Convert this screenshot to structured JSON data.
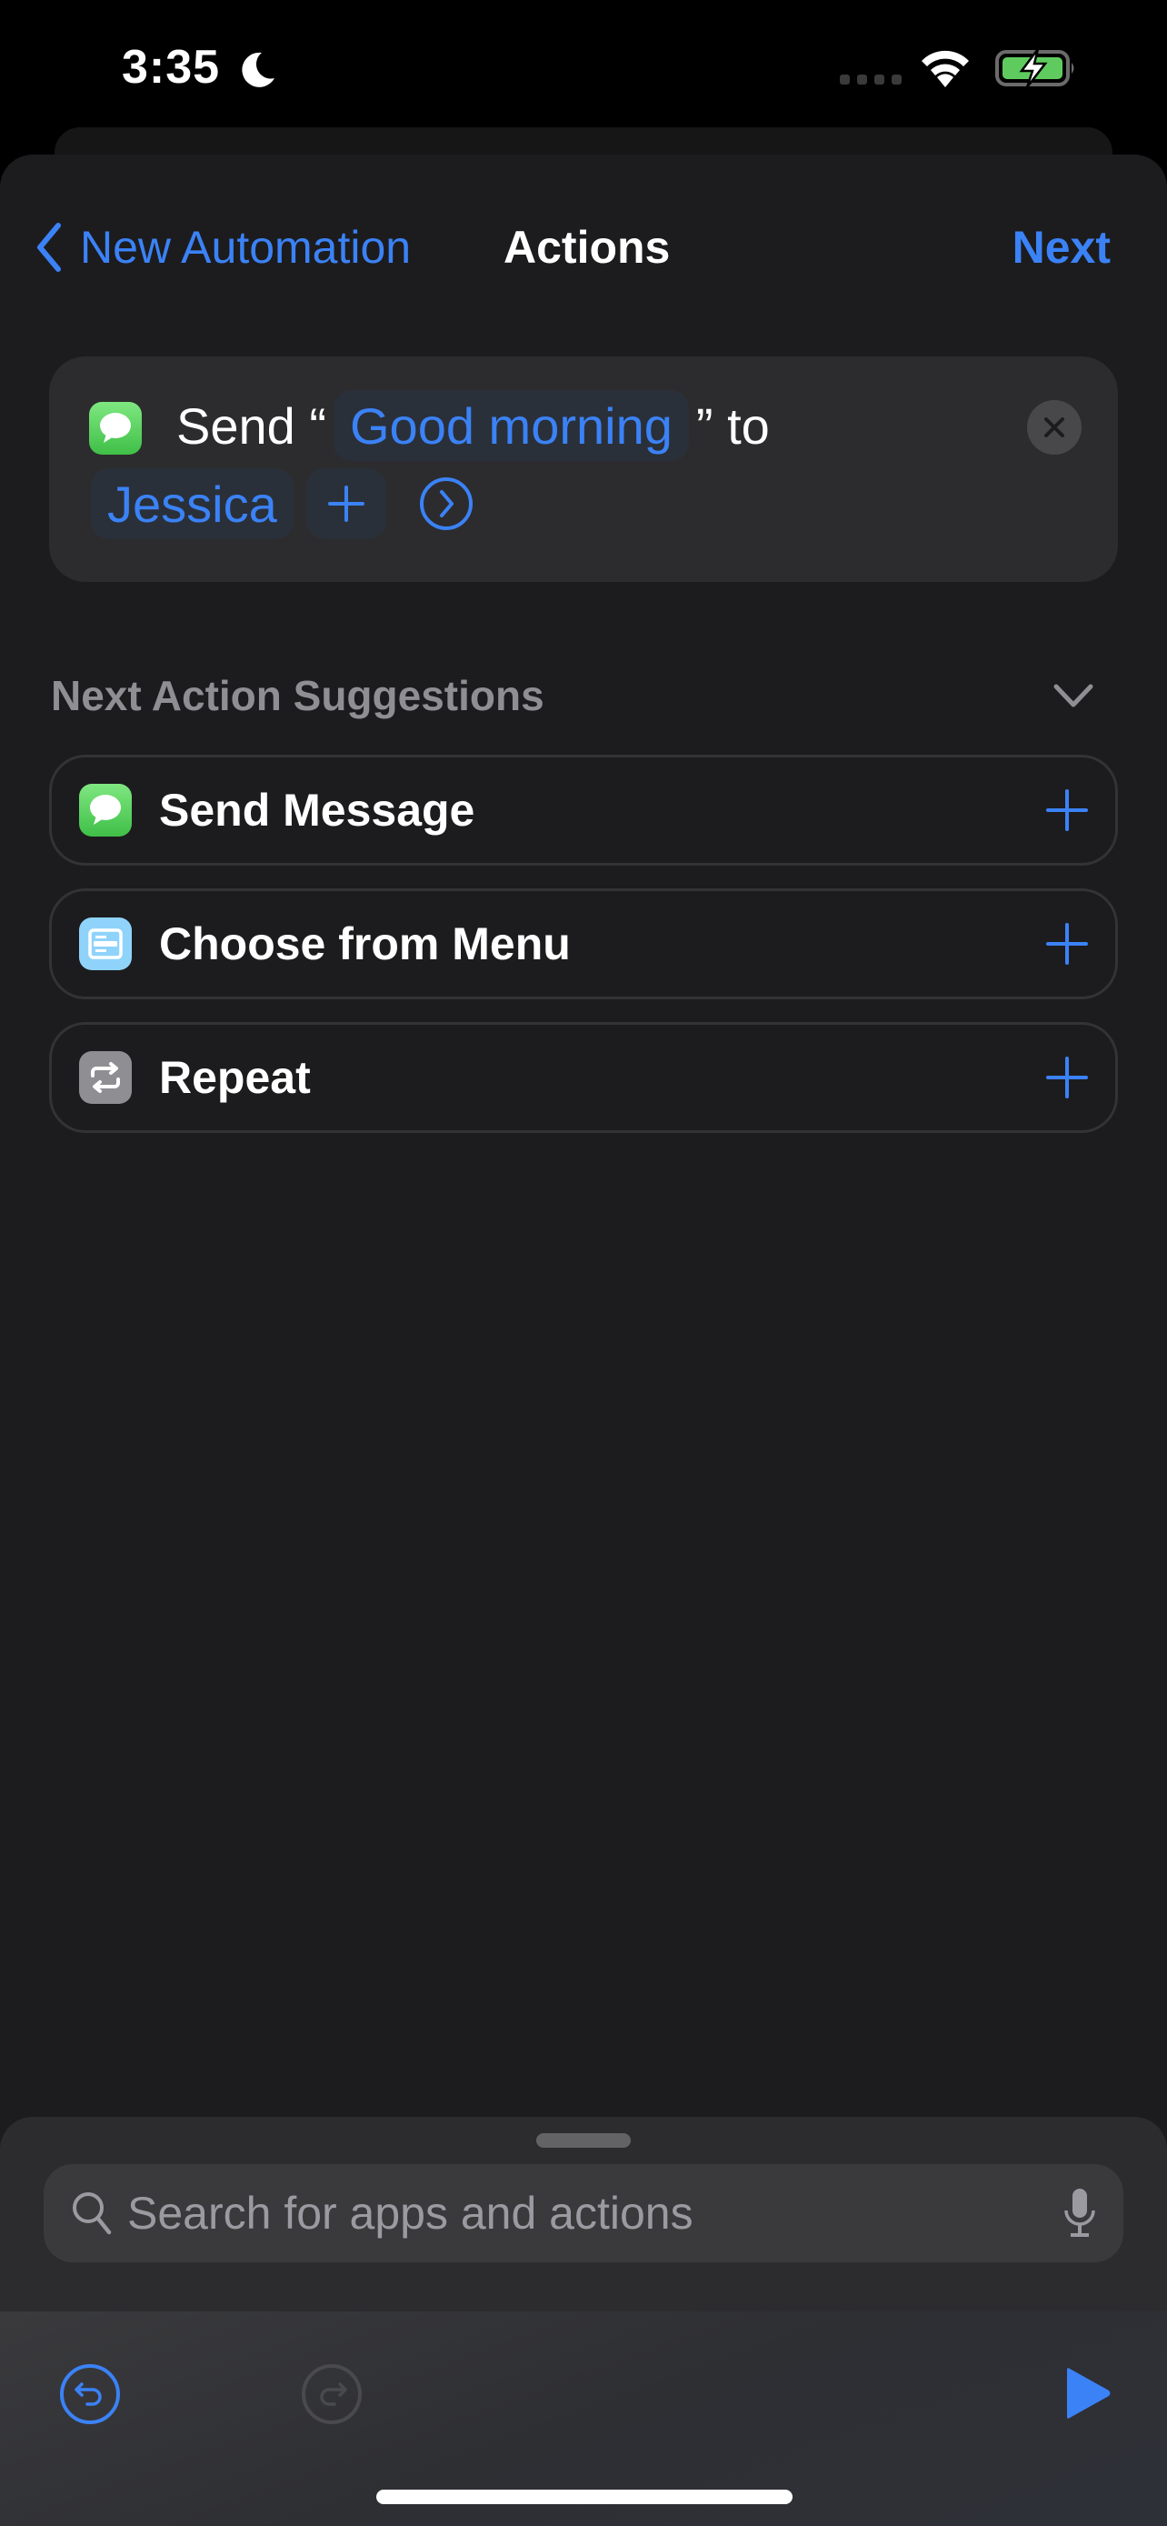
{
  "status_bar": {
    "time": "3:35",
    "focus_icon": "moon-icon",
    "wifi_icon": "wifi-icon",
    "battery_icon": "battery-charging-icon",
    "battery_color": "#5fcb5f"
  },
  "nav": {
    "back_label": "New Automation",
    "title": "Actions",
    "next_label": "Next"
  },
  "action": {
    "app_icon": "messages-icon",
    "prefix": "Send “",
    "message_token": "Good morning",
    "middle": "” to",
    "recipient_token": "Jessica",
    "add_recipient_icon": "plus-icon",
    "expand_icon": "chevron-right-circle-icon",
    "remove_icon": "close-icon"
  },
  "suggestions": {
    "title": "Next Action Suggestions",
    "collapse_icon": "chevron-down-icon",
    "items": [
      {
        "label": "Send Message",
        "icon": "messages-icon"
      },
      {
        "label": "Choose from Menu",
        "icon": "menu-icon"
      },
      {
        "label": "Repeat",
        "icon": "repeat-icon"
      }
    ]
  },
  "search": {
    "placeholder": "Search for apps and actions",
    "value": ""
  },
  "toolbar": {
    "undo_icon": "undo-icon",
    "redo_icon": "redo-icon",
    "play_icon": "play-icon"
  },
  "colors": {
    "accent": "#3b82f6",
    "background": "#1c1c1e",
    "card": "#2c2c2e",
    "secondary_text": "#8e8e93"
  }
}
